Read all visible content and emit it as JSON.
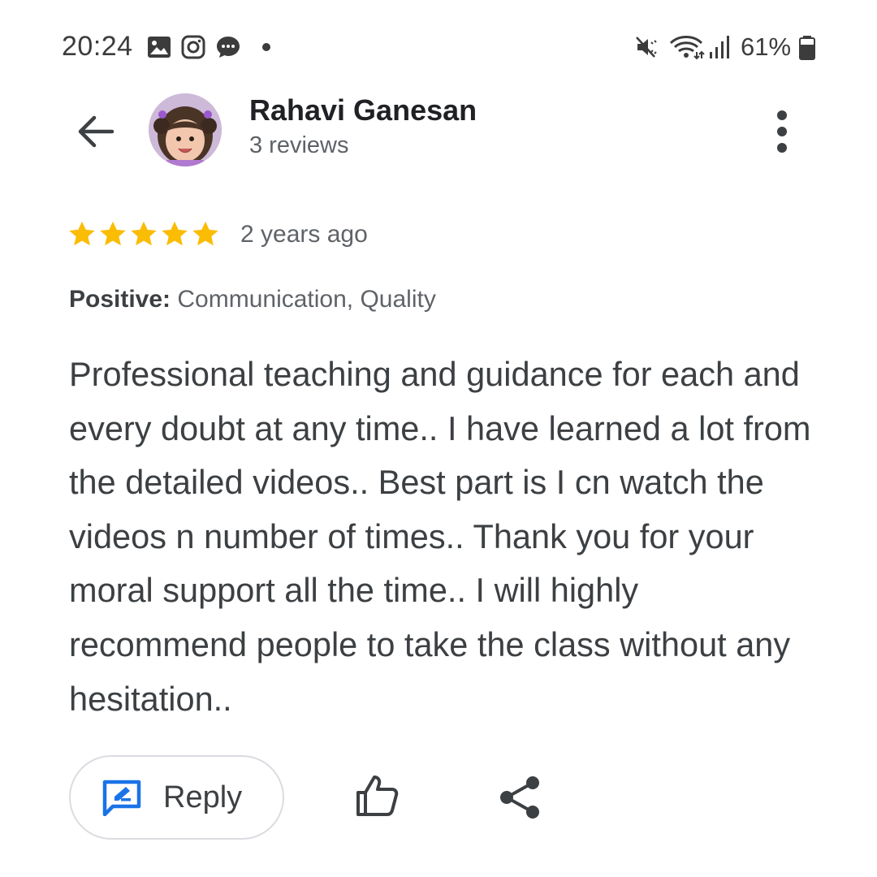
{
  "status_bar": {
    "time": "20:24",
    "notification_icons": [
      "gallery-icon",
      "instagram-icon",
      "messages-icon"
    ],
    "system_icons": [
      "mute-icon",
      "wifi-icon",
      "signal-icon",
      "battery-icon"
    ],
    "battery_percent": "61%"
  },
  "header": {
    "reviewer_name": "Rahavi Ganesan",
    "review_count": "3 reviews"
  },
  "review": {
    "rating": 5,
    "max_rating": 5,
    "time_ago": "2 years ago",
    "attributes_label": "Positive:",
    "attributes_value": " Communication, Quality",
    "text": "Professional teaching and guidance for each and every doubt at any time.. I have learned a lot from the detailed videos.. Best part is I cn watch the videos n number of times.. Thank you for your moral support all the time.. I will highly recommend people to take the class without any hesitation.."
  },
  "actions": {
    "reply_label": "Reply"
  },
  "colors": {
    "star": "#fbbc04",
    "reply_icon": "#1a73e8",
    "text_primary": "#202124",
    "text_secondary": "#5f6368"
  }
}
